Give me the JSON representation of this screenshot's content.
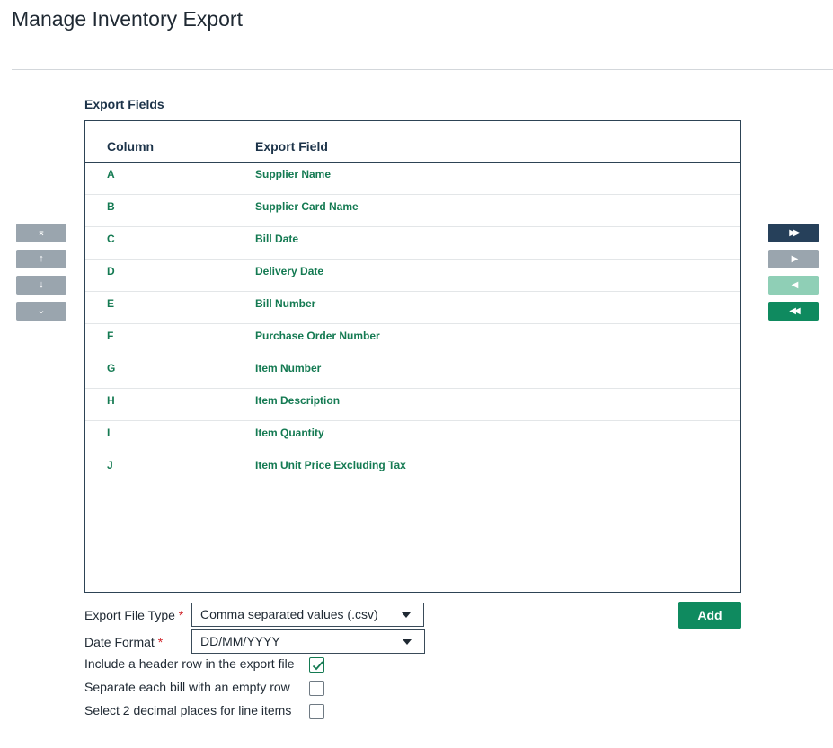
{
  "page": {
    "title": "Manage Inventory Export"
  },
  "export_fields": {
    "section_label": "Export Fields",
    "headers": {
      "column": "Column",
      "field": "Export Field"
    },
    "rows": [
      {
        "column": "A",
        "field": "Supplier Name"
      },
      {
        "column": "B",
        "field": "Supplier Card Name"
      },
      {
        "column": "C",
        "field": "Bill Date"
      },
      {
        "column": "D",
        "field": "Delivery Date"
      },
      {
        "column": "E",
        "field": "Bill Number"
      },
      {
        "column": "F",
        "field": "Purchase Order Number"
      },
      {
        "column": "G",
        "field": "Item Number"
      },
      {
        "column": "H",
        "field": "Item Description"
      },
      {
        "column": "I",
        "field": "Item Quantity"
      },
      {
        "column": "J",
        "field": "Item Unit Price Excluding Tax"
      }
    ]
  },
  "order_buttons": [
    {
      "icon": "move-to-top-icon",
      "glyph": "⌅"
    },
    {
      "icon": "move-up-icon",
      "glyph": "↑"
    },
    {
      "icon": "move-down-icon",
      "glyph": "↓"
    },
    {
      "icon": "move-to-bottom-icon",
      "glyph": "⌄"
    }
  ],
  "move_buttons": [
    {
      "icon": "move-all-right-icon",
      "glyph": "▶▶",
      "color": "#26405a"
    },
    {
      "icon": "move-right-icon",
      "glyph": "▶",
      "color": "#9aa5ae"
    },
    {
      "icon": "move-left-icon",
      "glyph": "◀",
      "color": "#8fcfb6"
    },
    {
      "icon": "move-all-left-icon",
      "glyph": "◀◀",
      "color": "#0f8a5f"
    }
  ],
  "form": {
    "file_type": {
      "label": "Export File Type",
      "required_mark": "*",
      "value": "Comma separated values (.csv)"
    },
    "date_format": {
      "label": "Date Format",
      "required_mark": "*",
      "value": "DD/MM/YYYY"
    },
    "header_row": {
      "label": "Include a header row in the export file",
      "checked": true
    },
    "empty_row": {
      "label": "Separate each bill with an empty row",
      "checked": false
    },
    "decimal_places": {
      "label": "Select 2 decimal places for line items",
      "checked": false
    },
    "add_label": "Add"
  },
  "colors": {
    "accent_green": "#0f8a5f",
    "field_text_green": "#147a52",
    "navy": "#26405a",
    "disabled_gray": "#9aa5ae",
    "required_red": "#d0262c"
  }
}
